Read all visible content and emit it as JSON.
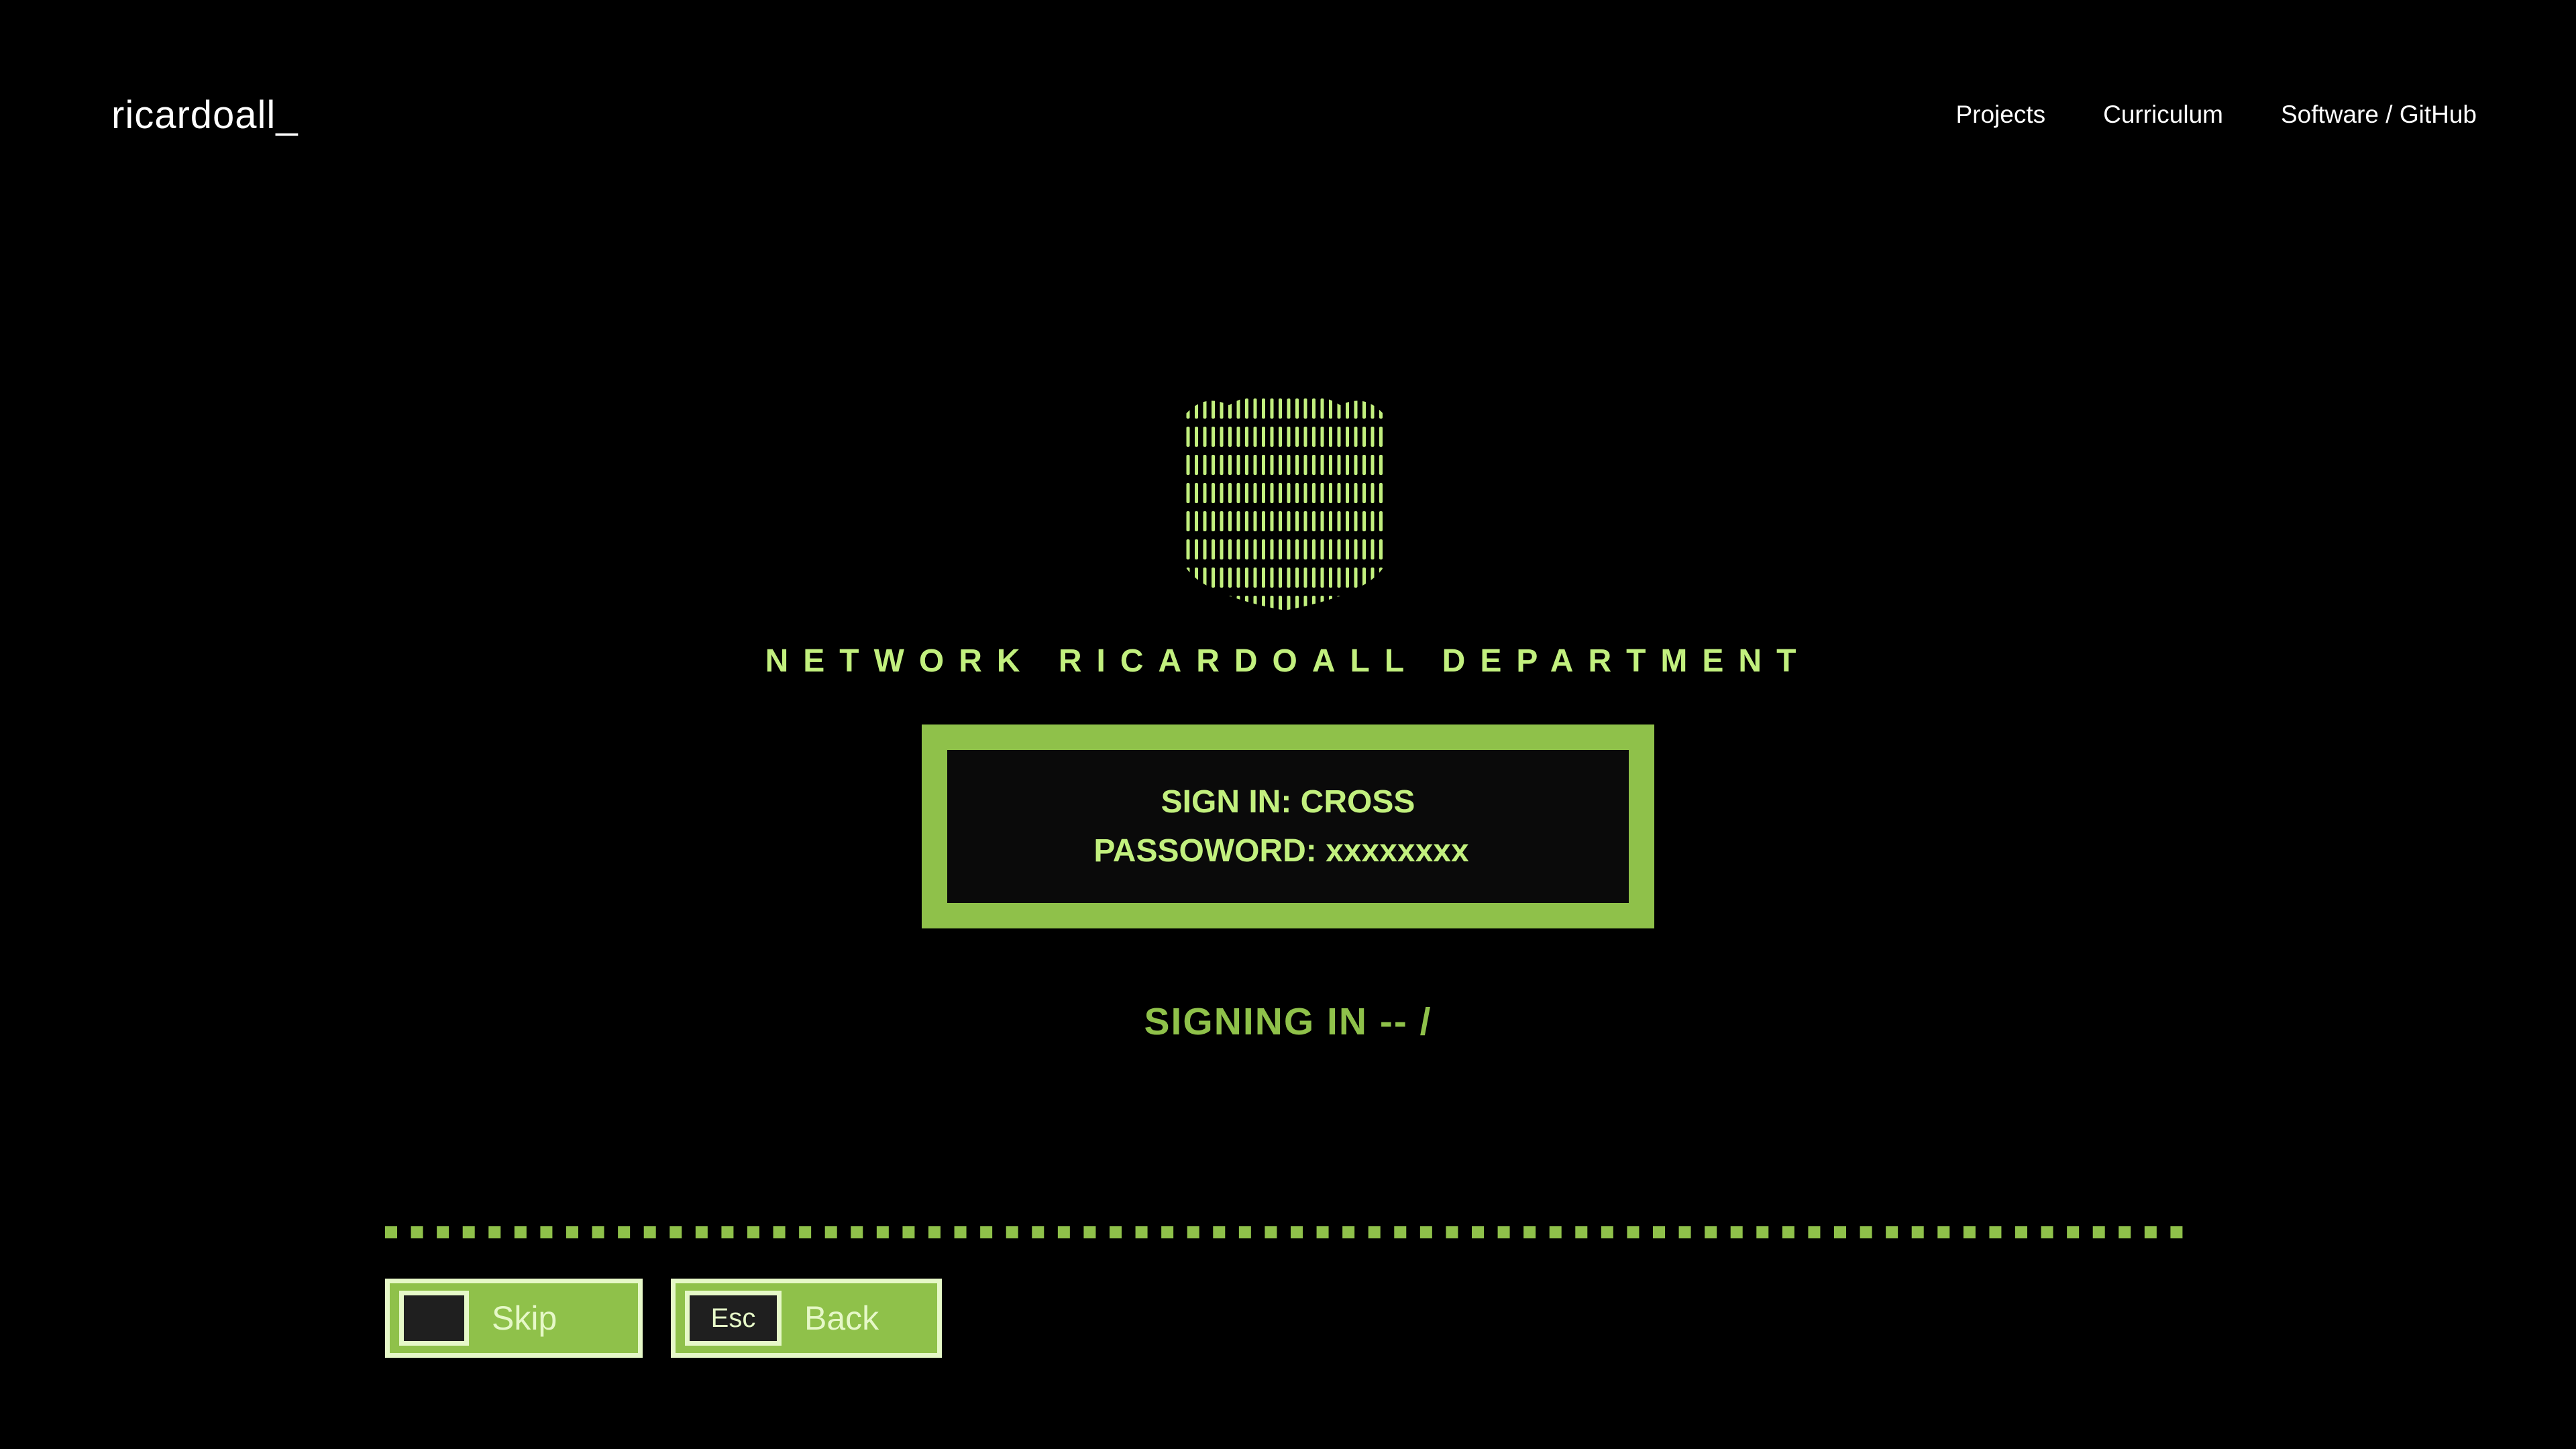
{
  "header": {
    "logo": "ricardoall_",
    "nav": [
      "Projects",
      "Curriculum",
      "Software / GitHub"
    ]
  },
  "main": {
    "emblem_icon": "shield-icon",
    "department": "NETWORK RICARDOALL DEPARTMENT",
    "login": {
      "sign_in": "SIGN IN: CROSS",
      "password": "PASSOWORD: xxxxxxxx"
    },
    "status": "SIGNING IN -- /",
    "progress": 1.0
  },
  "controls": {
    "skip_key": "",
    "skip_label": "Skip",
    "back_key": "Esc",
    "back_label": "Back"
  },
  "colors": {
    "accent": "#8fc14a",
    "text_green": "#c2f07e",
    "background": "#000000"
  }
}
